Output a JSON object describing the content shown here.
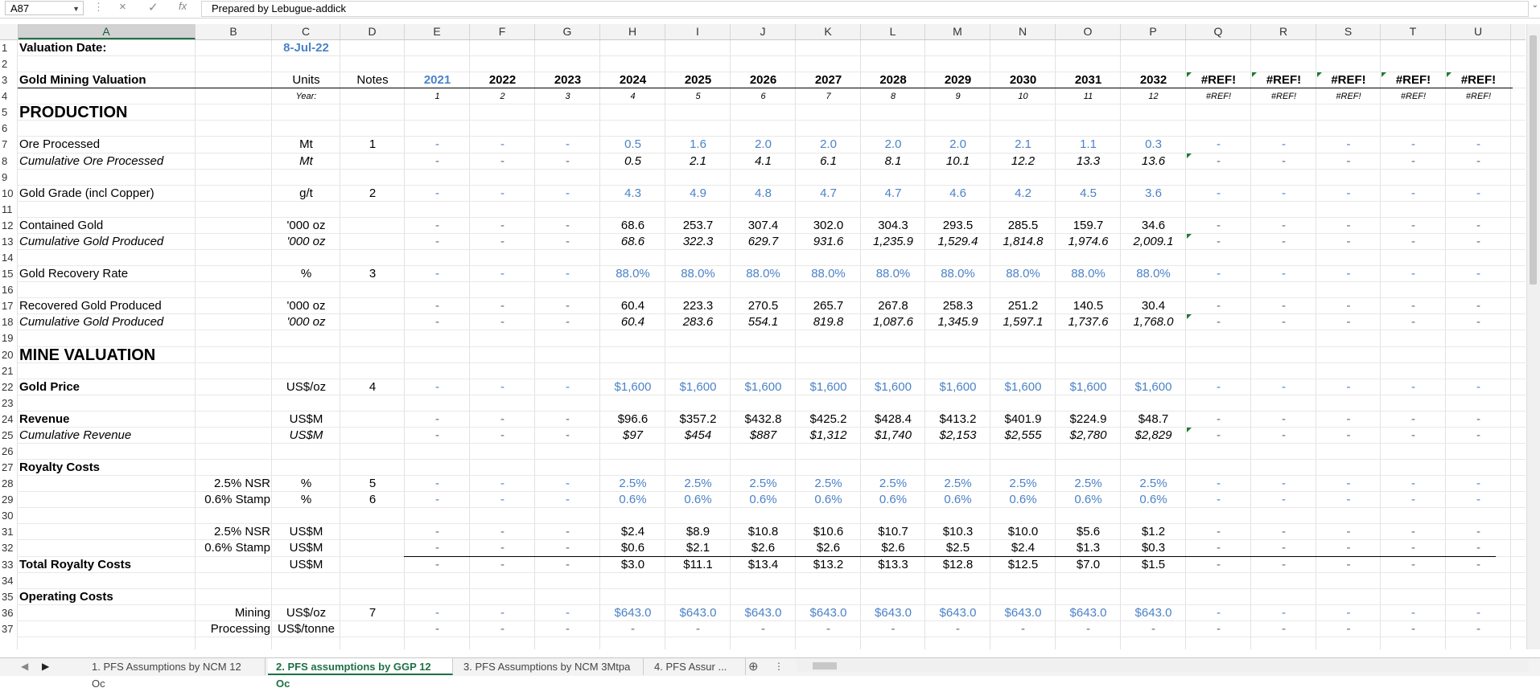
{
  "formula_bar": {
    "name_box": "A87",
    "cancel_icon": "×",
    "enter_icon": "✓",
    "fx_label": "fx",
    "formula": "Prepared by Lebugue-addick"
  },
  "columns": [
    "A",
    "B",
    "C",
    "D",
    "E",
    "F",
    "G",
    "H",
    "I",
    "J",
    "K",
    "L",
    "M",
    "N",
    "O",
    "P",
    "Q",
    "R",
    "S",
    "T",
    "U"
  ],
  "row_numbers": [
    "1",
    "2",
    "3",
    "4",
    "5",
    "6",
    "7",
    "8",
    "9",
    "10",
    "11",
    "12",
    "13",
    "14",
    "15",
    "16",
    "17",
    "18",
    "19",
    "20",
    "21",
    "22",
    "23",
    "24",
    "25",
    "26",
    "27",
    "28",
    "29",
    "30",
    "31",
    "32",
    "33",
    "34",
    "35",
    "36",
    "37"
  ],
  "header": {
    "valuation_label": "Valuation Date:",
    "valuation_date": "8-Jul-22",
    "title": "Gold Mining Valuation",
    "units_label": "Units",
    "notes_label": "Notes",
    "year_label": "Year:",
    "years": [
      "2021",
      "2022",
      "2023",
      "2024",
      "2025",
      "2026",
      "2027",
      "2028",
      "2029",
      "2030",
      "2031",
      "2032",
      "#REF!",
      "#REF!",
      "#REF!",
      "#REF!",
      "#REF!"
    ],
    "year_index": [
      "1",
      "2",
      "3",
      "4",
      "5",
      "6",
      "7",
      "8",
      "9",
      "10",
      "11",
      "12",
      "#REF!",
      "#REF!",
      "#REF!",
      "#REF!",
      "#REF!"
    ]
  },
  "sections": {
    "production": "PRODUCTION",
    "mine_valuation": "MINE VALUATION"
  },
  "rows": {
    "r7": {
      "label": "Ore Processed",
      "unit": "Mt",
      "note": "1",
      "vals": [
        "-",
        "-",
        "-",
        "0.5",
        "1.6",
        "2.0",
        "2.0",
        "2.0",
        "2.0",
        "2.1",
        "1.1",
        "0.3",
        "-",
        "-",
        "-",
        "-",
        "-"
      ]
    },
    "r8": {
      "label": "Cumulative Ore Processed",
      "unit": "Mt",
      "note": "",
      "vals": [
        "-",
        "-",
        "-",
        "0.5",
        "2.1",
        "4.1",
        "6.1",
        "8.1",
        "10.1",
        "12.2",
        "13.3",
        "13.6",
        "-",
        "-",
        "-",
        "-",
        "-"
      ]
    },
    "r10": {
      "label": "Gold Grade (incl Copper)",
      "unit": "g/t",
      "note": "2",
      "vals": [
        "-",
        "-",
        "-",
        "4.3",
        "4.9",
        "4.8",
        "4.7",
        "4.7",
        "4.6",
        "4.2",
        "4.5",
        "3.6",
        "-",
        "-",
        "-",
        "-",
        "-"
      ]
    },
    "r12": {
      "label": "Contained Gold",
      "unit": "'000 oz",
      "note": "",
      "vals": [
        "-",
        "-",
        "-",
        "68.6",
        "253.7",
        "307.4",
        "302.0",
        "304.3",
        "293.5",
        "285.5",
        "159.7",
        "34.6",
        "-",
        "-",
        "-",
        "-",
        "-"
      ]
    },
    "r13": {
      "label": "Cumulative Gold Produced",
      "unit": "'000 oz",
      "note": "",
      "vals": [
        "-",
        "-",
        "-",
        "68.6",
        "322.3",
        "629.7",
        "931.6",
        "1,235.9",
        "1,529.4",
        "1,814.8",
        "1,974.6",
        "2,009.1",
        "-",
        "-",
        "-",
        "-",
        "-"
      ]
    },
    "r15": {
      "label": "Gold Recovery Rate",
      "unit": "%",
      "note": "3",
      "vals": [
        "-",
        "-",
        "-",
        "88.0%",
        "88.0%",
        "88.0%",
        "88.0%",
        "88.0%",
        "88.0%",
        "88.0%",
        "88.0%",
        "88.0%",
        "-",
        "-",
        "-",
        "-",
        "-"
      ]
    },
    "r17": {
      "label": "Recovered Gold Produced",
      "unit": "'000 oz",
      "note": "",
      "vals": [
        "-",
        "-",
        "-",
        "60.4",
        "223.3",
        "270.5",
        "265.7",
        "267.8",
        "258.3",
        "251.2",
        "140.5",
        "30.4",
        "-",
        "-",
        "-",
        "-",
        "-"
      ]
    },
    "r18": {
      "label": "Cumulative Gold Produced",
      "unit": "'000 oz",
      "note": "",
      "vals": [
        "-",
        "-",
        "-",
        "60.4",
        "283.6",
        "554.1",
        "819.8",
        "1,087.6",
        "1,345.9",
        "1,597.1",
        "1,737.6",
        "1,768.0",
        "-",
        "-",
        "-",
        "-",
        "-"
      ]
    },
    "r22": {
      "label": "Gold Price",
      "unit": "US$/oz",
      "note": "4",
      "vals": [
        "-",
        "-",
        "-",
        "$1,600",
        "$1,600",
        "$1,600",
        "$1,600",
        "$1,600",
        "$1,600",
        "$1,600",
        "$1,600",
        "$1,600",
        "-",
        "-",
        "-",
        "-",
        "-"
      ]
    },
    "r24": {
      "label": "Revenue",
      "unit": "US$M",
      "note": "",
      "vals": [
        "-",
        "-",
        "-",
        "$96.6",
        "$357.2",
        "$432.8",
        "$425.2",
        "$428.4",
        "$413.2",
        "$401.9",
        "$224.9",
        "$48.7",
        "-",
        "-",
        "-",
        "-",
        "-"
      ]
    },
    "r25": {
      "label": "Cumulative Revenue",
      "unit": "US$M",
      "note": "",
      "vals": [
        "-",
        "-",
        "-",
        "$97",
        "$454",
        "$887",
        "$1,312",
        "$1,740",
        "$2,153",
        "$2,555",
        "$2,780",
        "$2,829",
        "-",
        "-",
        "-",
        "-",
        "-"
      ]
    },
    "r27": {
      "label": "Royalty Costs"
    },
    "r28": {
      "sub": "2.5% NSR",
      "unit": "%",
      "note": "5",
      "vals": [
        "-",
        "-",
        "-",
        "2.5%",
        "2.5%",
        "2.5%",
        "2.5%",
        "2.5%",
        "2.5%",
        "2.5%",
        "2.5%",
        "2.5%",
        "-",
        "-",
        "-",
        "-",
        "-"
      ]
    },
    "r29": {
      "sub": "0.6% Stamp",
      "unit": "%",
      "note": "6",
      "vals": [
        "-",
        "-",
        "-",
        "0.6%",
        "0.6%",
        "0.6%",
        "0.6%",
        "0.6%",
        "0.6%",
        "0.6%",
        "0.6%",
        "0.6%",
        "-",
        "-",
        "-",
        "-",
        "-"
      ]
    },
    "r31": {
      "sub": "2.5% NSR",
      "unit": "US$M",
      "note": "",
      "vals": [
        "-",
        "-",
        "-",
        "$2.4",
        "$8.9",
        "$10.8",
        "$10.6",
        "$10.7",
        "$10.3",
        "$10.0",
        "$5.6",
        "$1.2",
        "-",
        "-",
        "-",
        "-",
        "-"
      ]
    },
    "r32": {
      "sub": "0.6% Stamp",
      "unit": "US$M",
      "note": "",
      "vals": [
        "-",
        "-",
        "-",
        "$0.6",
        "$2.1",
        "$2.6",
        "$2.6",
        "$2.6",
        "$2.5",
        "$2.4",
        "$1.3",
        "$0.3",
        "-",
        "-",
        "-",
        "-",
        "-"
      ]
    },
    "r33": {
      "label": "Total Royalty Costs",
      "unit": "US$M",
      "note": "",
      "vals": [
        "-",
        "-",
        "-",
        "$3.0",
        "$11.1",
        "$13.4",
        "$13.2",
        "$13.3",
        "$12.8",
        "$12.5",
        "$7.0",
        "$1.5",
        "-",
        "-",
        "-",
        "-",
        "-"
      ]
    },
    "r35": {
      "label": "Operating Costs"
    },
    "r36": {
      "sub": "Mining",
      "unit": "US$/oz",
      "note": "7",
      "vals": [
        "-",
        "-",
        "-",
        "$643.0",
        "$643.0",
        "$643.0",
        "$643.0",
        "$643.0",
        "$643.0",
        "$643.0",
        "$643.0",
        "$643.0",
        "-",
        "-",
        "-",
        "-",
        "-"
      ]
    },
    "r37": {
      "sub": "Processing",
      "unit": "US$/tonne",
      "note": "",
      "vals": [
        "-",
        "-",
        "-",
        "-",
        "-",
        "-",
        "-",
        "-",
        "-",
        "-",
        "-",
        "-",
        "-",
        "-",
        "-",
        "-",
        "-"
      ]
    }
  },
  "tabs": [
    "1. PFS Assumptions by NCM 12 Oc",
    "2. PFS assumptions by GGP 12 Oc",
    "3. PFS Assumptions by NCM 3Mtpa",
    "4. PFS Assur ..."
  ],
  "active_tab": 1,
  "colors": {
    "input_blue": "#4b82c8",
    "excel_green": "#217346"
  }
}
